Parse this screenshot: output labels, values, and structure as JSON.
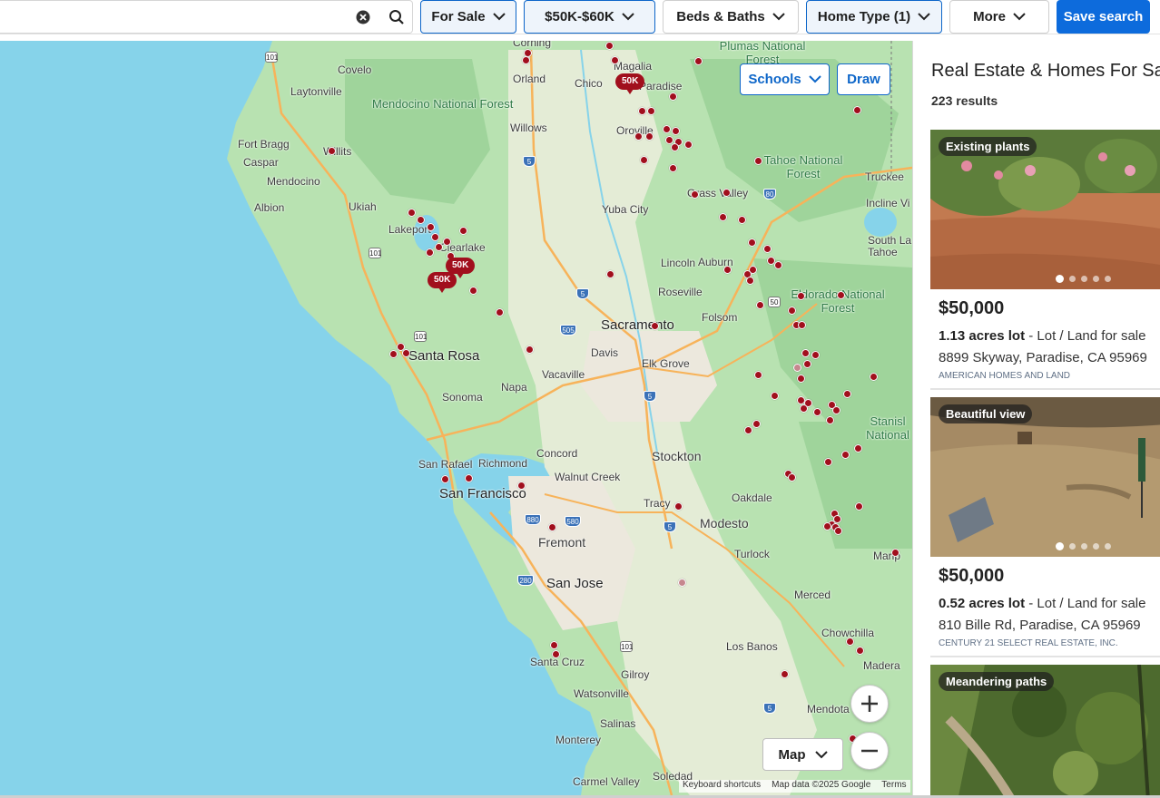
{
  "search": {
    "value": "",
    "placeholder": ""
  },
  "filters": [
    {
      "label": "For Sale",
      "active": true
    },
    {
      "label": "$50K-$60K",
      "active": true
    },
    {
      "label": "Beds & Baths",
      "active": false
    },
    {
      "label": "Home Type (1)",
      "active": true
    },
    {
      "label": "More",
      "active": false
    }
  ],
  "save_search_label": "Save search",
  "map": {
    "schools_label": "Schools",
    "draw_label": "Draw",
    "map_type_label": "Map",
    "attribution": {
      "shortcuts": "Keyboard shortcuts",
      "data": "Map data ©2025 Google",
      "terms": "Terms"
    },
    "cluster_label": "50K",
    "labels": {
      "covelo": "Covelo",
      "laytonville": "Laytonville",
      "fort_bragg": "Fort Bragg",
      "willits": "Willits",
      "caspar": "Caspar",
      "mendocino": "Mendocino",
      "albion": "Albion",
      "ukiah": "Ukiah",
      "lakeport": "Lakeport",
      "clearlake": "Clearlake",
      "santa_rosa": "Santa Rosa",
      "sonoma": "Sonoma",
      "napa": "Napa",
      "vacaville": "Vacaville",
      "davis": "Davis",
      "sacramento": "Sacramento",
      "elk_grove": "Elk Grove",
      "folsom": "Folsom",
      "roseville": "Roseville",
      "lincoln": "Lincoln",
      "auburn": "Auburn",
      "yuba_city": "Yuba City",
      "oroville": "Oroville",
      "chico": "Chico",
      "paradise": "Paradise",
      "magalia": "Magalia",
      "orland": "Orland",
      "willows": "Willows",
      "corning": "Corning",
      "grass_valley": "Grass Valley",
      "truckee": "Truckee",
      "incline_village": "Incline Vi",
      "south_lake_tahoe": "South La Tahoe",
      "concord": "Concord",
      "walnut_creek": "Walnut Creek",
      "richmond": "Richmond",
      "san_rafael": "San Rafael",
      "san_francisco": "San Francisco",
      "fremont": "Fremont",
      "san_jose": "San Jose",
      "stockton": "Stockton",
      "tracy": "Tracy",
      "oakdale": "Oakdale",
      "modesto": "Modesto",
      "turlock": "Turlock",
      "merced": "Merced",
      "chowchilla": "Chowchilla",
      "madera": "Madera",
      "los_banos": "Los Banos",
      "gilroy": "Gilroy",
      "watsonville": "Watsonville",
      "santa_cruz": "Santa Cruz",
      "salinas": "Salinas",
      "monterey": "Monterey",
      "carmel_valley": "Carmel Valley",
      "soledad": "Soledad",
      "mendota": "Mendota",
      "mariposa": "Marip",
      "mendocino_nf": "Mendocino National Forest",
      "plumas_nf": "Plumas National Forest",
      "tahoe_nf": "Tahoe National Forest",
      "eldorado_nf": "Eldorado National Forest",
      "stanislaus_nf": "Stanisl National"
    },
    "shields": {
      "i5": "5",
      "i80": "80",
      "i505": "505",
      "i50": "50",
      "i880": "880",
      "i580": "580",
      "i280": "280",
      "us101": "101"
    }
  },
  "results": {
    "title": "Real Estate & Homes For Sale",
    "count": "223 results",
    "listings": [
      {
        "tag": "Existing plants",
        "price": "$50,000",
        "lot_size": "1.13 acres lot",
        "lot_type": " - Lot / Land for sale",
        "address": "8899 Skyway, Paradise, CA 95969",
        "broker": "AMERICAN HOMES AND LAND"
      },
      {
        "tag": "Beautiful view",
        "price": "$50,000",
        "lot_size": "0.52 acres lot",
        "lot_type": " - Lot / Land for sale",
        "address": "810 Bille Rd, Paradise, CA 95969",
        "broker": "CENTURY 21 SELECT REAL ESTATE, INC."
      },
      {
        "tag": "Meandering paths"
      }
    ]
  },
  "colors": {
    "accent": "#0d6bdc",
    "marker": "#a10f1d",
    "water": "#86d3ea",
    "land": "#b8e2b1"
  },
  "icons": {
    "clear": "close-circle-icon",
    "search": "magnifier-icon",
    "chevron": "chevron-down-icon",
    "zoom_in": "plus-icon",
    "zoom_out": "minus-icon"
  }
}
